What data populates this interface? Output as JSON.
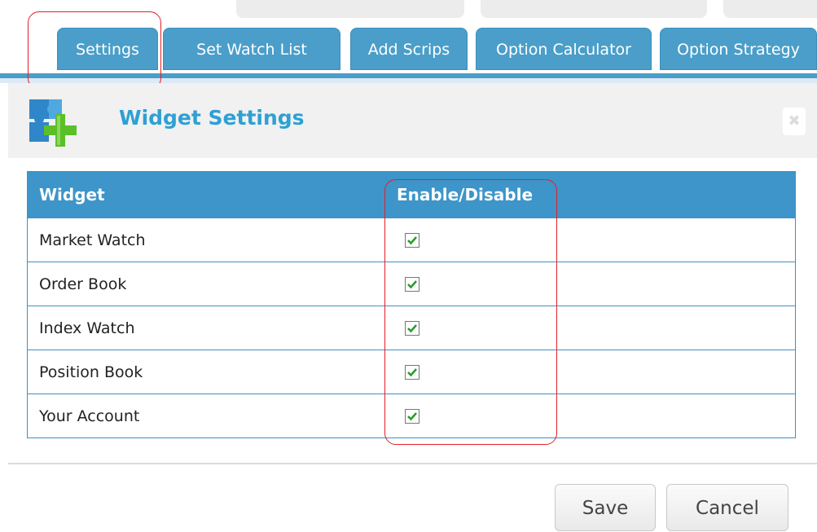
{
  "tabs": [
    {
      "label": "Settings"
    },
    {
      "label": "Set Watch List"
    },
    {
      "label": "Add Scrips"
    },
    {
      "label": "Option Calculator"
    },
    {
      "label": "Option Strategy"
    }
  ],
  "dialog": {
    "title": "Widget Settings",
    "icon": "puzzle-plus-icon",
    "close_icon": "close-icon"
  },
  "table": {
    "headers": [
      "Widget",
      "Enable/Disable"
    ],
    "rows": [
      {
        "name": "Market Watch",
        "enabled": true
      },
      {
        "name": "Order Book",
        "enabled": true
      },
      {
        "name": "Index Watch",
        "enabled": true
      },
      {
        "name": "Position Book",
        "enabled": true
      },
      {
        "name": "Your Account",
        "enabled": true
      }
    ]
  },
  "buttons": {
    "save": "Save",
    "cancel": "Cancel"
  },
  "colors": {
    "tab_blue": "#4a9ec9",
    "header_blue": "#3d95c9",
    "title_blue": "#2ea0d4",
    "annotation_red": "#e0202a",
    "check_green": "#2a9d2a"
  }
}
